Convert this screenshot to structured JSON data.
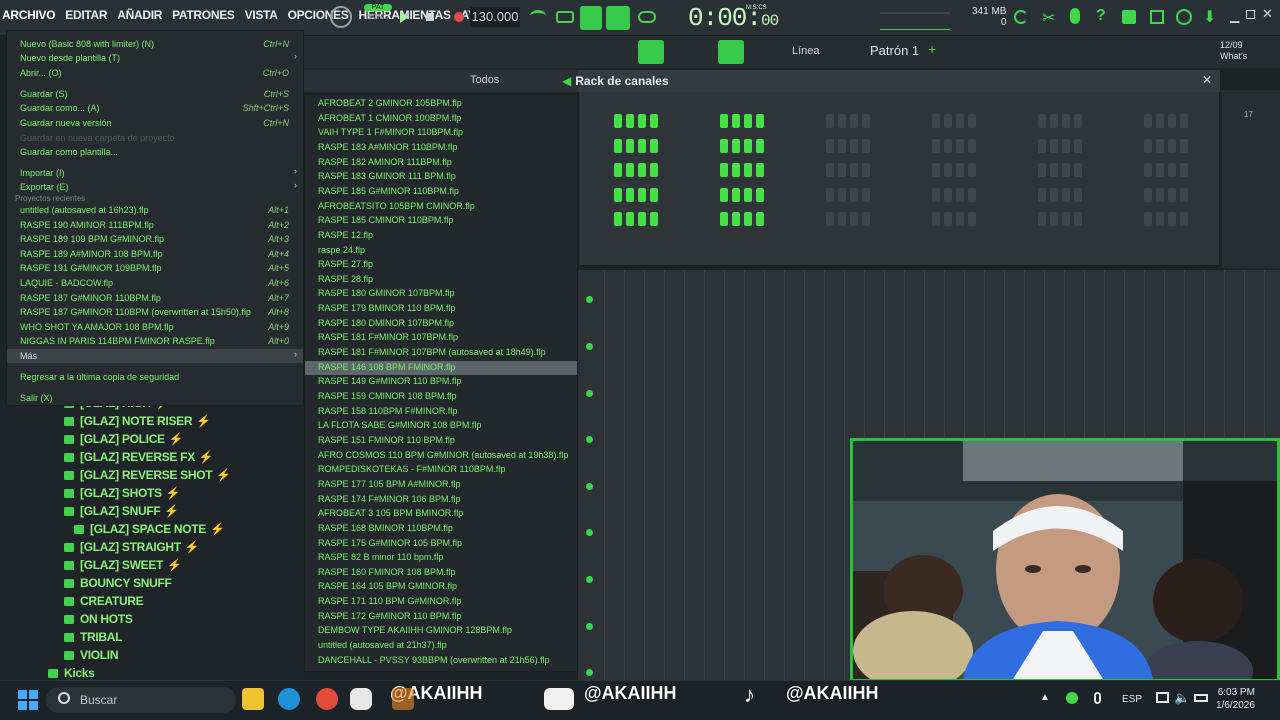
{
  "menubar": [
    "ARCHIVO",
    "EDITAR",
    "AÑADIR",
    "PATRONES",
    "VISTA",
    "OPCIONES",
    "HERRAMIENTAS",
    "AYU"
  ],
  "transport": {
    "pat_label": "PAT",
    "song_label": "SONG",
    "tempo": "130.000",
    "time_main": "0:00",
    "time_sub": "00",
    "time_unit": "M:S:CS"
  },
  "status": {
    "memory": "341 MB",
    "cpu": "0",
    "pattern": "Patrón 1",
    "snap": "Línea",
    "date_short": "12/09",
    "whats": "What's"
  },
  "browser": {
    "filter": "Todos"
  },
  "rack": {
    "title": "Rack de canales",
    "corner_number": "17"
  },
  "file_menu": {
    "items": [
      {
        "label": "Nuevo (Basic 808 with limiter) (N)",
        "shortcut": "Ctrl+N"
      },
      {
        "label": "Nuevo desde plantilla (T)",
        "shortcut": "",
        "arrow": true
      },
      {
        "label": "Abrir... (O)",
        "shortcut": "Ctrl+O"
      },
      {
        "label": "Guardar (S)",
        "shortcut": "Ctrl+S"
      },
      {
        "label": "Guardar como... (A)",
        "shortcut": "Shft+Ctrl+S"
      },
      {
        "label": "Guardar nueva versión",
        "shortcut": "Ctrl+N"
      },
      {
        "label": "Guardar en nueva carpeta de proyecto",
        "shortcut": "",
        "dim": true
      },
      {
        "label": "Guardar como plantilla...",
        "shortcut": ""
      },
      {
        "label": "Importar (I)",
        "shortcut": "",
        "arrow": true
      },
      {
        "label": "Exportar (E)",
        "shortcut": "",
        "arrow": true
      }
    ],
    "recent_header": "Proyectos recientes",
    "recent": [
      {
        "label": "untitled (autosaved at 16h23).flp",
        "shortcut": "Alt+1"
      },
      {
        "label": "RASPE 190 AMINOR 111BPM.flp",
        "shortcut": "Alt+2"
      },
      {
        "label": "RASPE 189 109 BPM G#MINOR.flp",
        "shortcut": "Alt+3"
      },
      {
        "label": "RASPE 189 A#MINOR 108 BPM.flp",
        "shortcut": "Alt+4"
      },
      {
        "label": "RASPE 191 G#MINOR 109BPM.flp",
        "shortcut": "Alt+5"
      },
      {
        "label": "LAQUIE - BADCOW.flp",
        "shortcut": "Alt+6"
      },
      {
        "label": "RASPE 187 G#MINOR 110BPM.flp",
        "shortcut": "Alt+7"
      },
      {
        "label": "RASPE 187 G#MINOR 110BPM (overwritten at 15h50).flp",
        "shortcut": "Alt+8"
      },
      {
        "label": "WHO SHOT YA AMAJOR 108 BPM.flp",
        "shortcut": "Alt+9"
      },
      {
        "label": "NIGGAS IN PARIS 114BPM FMINOR RASPE.flp",
        "shortcut": "Alt+0"
      }
    ],
    "more": "Más",
    "restore": "Regresar a la última copia de seguridad",
    "exit": "Salir (X)"
  },
  "more_list": [
    "AFROBEAT 2 GMINOR 105BPM.flp",
    "AFROBEAT 1 CMINOR 100BPM.flp",
    "VAIH TYPE 1 F#MINOR 110BPM.flp",
    "RASPE 183 A#MINOR 110BPM.flp",
    "RASPE 182 AMINOR 111BPM.flp",
    "RASPE 183 GMINOR 111 BPM.flp",
    "RASPE 185 G#MINOR 110BPM.flp",
    "AFROBEATSITO 105BPM CMINOR.flp",
    "RASPE 185 CMINOR 110BPM.flp",
    "RASPE 12.flp",
    "raspe 24.flp",
    "RASPE 27.flp",
    "RASPE 28.flp",
    "RASPE 180 GMINOR 107BPM.flp",
    "RASPE 179 BMINOR 110 BPM.flp",
    "RASPE 180 DMINOR 107BPM.flp",
    "RASPE 181 F#MINOR 107BPM.flp",
    "RASPE 181 F#MINOR 107BPM (autosaved at 18h49).flp",
    "RASPE 146 108 BPM FMINOR.flp",
    "RASPE 149 G#MINOR 110 BPM.flp",
    "RASPE 159 CMINOR 108 BPM.flp",
    "RASPE 158 110BPM F#MINOR.flp",
    "LA FLOTA SABE G#MINOR 108 BPM.flp",
    "RASPE 151 FMINOR 110 BPM.flp",
    "AFRO COSMOS 110 BPM G#MINOR (autosaved at 19h38).flp",
    "ROMPEDISKOTEKAS - F#MINOR 110BPM.flp",
    "RASPE 177 105 BPM A#MINOR.flp",
    "RASPE 174 F#MINOR 106 BPM.flp",
    "AFROBEAT 3 105 BPM BMINOR.flp",
    "RASPE 168 BMINOR 110BPM.flp",
    "RASPE 175 G#MINOR 105 BPM.flp",
    "RASPE 82 B minor 110 bpm.flp",
    "RASPE 160 FMINOR 108 BPM.flp",
    "RASPE 164 105 BPM GMINOR.flp",
    "RASPE 171 110 BPM G#MINOR.flp",
    "RASPE 172 G#MINOR 110 BPM.flp",
    "DEMBOW TYPE AKAIIHH GMINOR 128BPM.flp",
    "untitled (autosaved at 21h37).flp",
    "DANCEHALL - PVSSY 93BBPM (overwritten at 21h56).flp"
  ],
  "more_selected_index": 18,
  "tree": [
    {
      "label": "[GLAZ] HIGH",
      "indent": 1,
      "bolt": true
    },
    {
      "label": "[GLAZ] NOTE RISER",
      "indent": 1,
      "bolt": true
    },
    {
      "label": "[GLAZ] POLICE",
      "indent": 1,
      "bolt": true
    },
    {
      "label": "[GLAZ] REVERSE FX",
      "indent": 1,
      "bolt": true
    },
    {
      "label": "[GLAZ] REVERSE SHOT",
      "indent": 1,
      "bolt": true
    },
    {
      "label": "[GLAZ] SHOTS",
      "indent": 1,
      "bolt": true
    },
    {
      "label": "[GLAZ] SNUFF",
      "indent": 1,
      "bolt": true
    },
    {
      "label": "[GLAZ] SPACE NOTE",
      "indent": 2,
      "bolt": true
    },
    {
      "label": "[GLAZ] STRAIGHT",
      "indent": 1,
      "bolt": true
    },
    {
      "label": "[GLAZ] SWEET",
      "indent": 1,
      "bolt": true
    },
    {
      "label": "BOUNCY SNUFF",
      "indent": 1,
      "bolt": false
    },
    {
      "label": "CREATURE",
      "indent": 1,
      "bolt": false
    },
    {
      "label": "ON HOTS",
      "indent": 1,
      "bolt": false
    },
    {
      "label": "TRIBAL",
      "indent": 1,
      "bolt": false
    },
    {
      "label": "VIOLIN",
      "indent": 1,
      "bolt": false
    },
    {
      "label": "Kicks",
      "indent": 0,
      "bolt": false
    }
  ],
  "taskbar": {
    "search_placeholder": "Buscar",
    "handle_ig": "@AKAIIHH",
    "handle_yt": "@AKAIIHH",
    "handle_tt": "@AKAIIHH",
    "lang": "ESP",
    "time": "6:03 PM",
    "date": "1/6/2026"
  },
  "colors": {
    "accent": "#3ed84a",
    "bg": "#1d2225",
    "menu_text": "#7ef070"
  }
}
